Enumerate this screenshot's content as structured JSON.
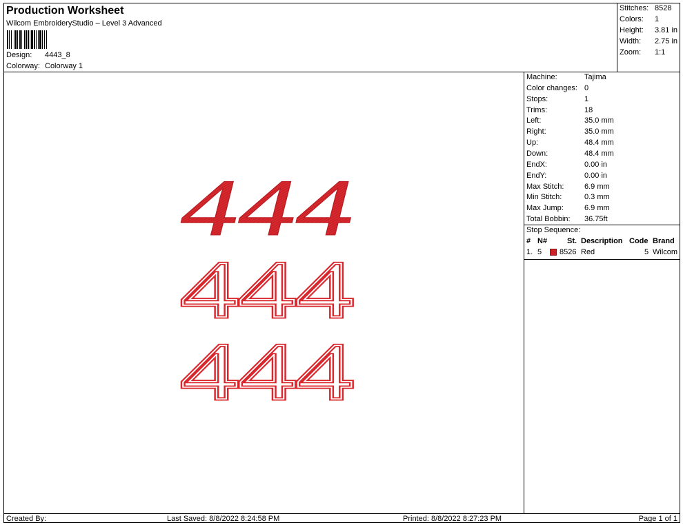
{
  "header": {
    "title": "Production Worksheet",
    "subtitle": "Wilcom EmbroideryStudio – Level 3 Advanced",
    "design_label": "Design:",
    "design_value": "4443_8",
    "colorway_label": "Colorway:",
    "colorway_value": "Colorway 1"
  },
  "top_stats": [
    {
      "label": "Stitches:",
      "value": "8528"
    },
    {
      "label": "Colors:",
      "value": "1"
    },
    {
      "label": "Height:",
      "value": "3.81 in"
    },
    {
      "label": "Width:",
      "value": "2.75 in"
    },
    {
      "label": "Zoom:",
      "value": "1:1"
    }
  ],
  "machine_info": [
    {
      "label": "Machine:",
      "value": "Tajima"
    },
    {
      "label": "Color changes:",
      "value": "0"
    },
    {
      "label": "Stops:",
      "value": "1"
    },
    {
      "label": "Trims:",
      "value": "18"
    },
    {
      "label": "Left:",
      "value": "35.0 mm"
    },
    {
      "label": "Right:",
      "value": "35.0 mm"
    },
    {
      "label": "Up:",
      "value": "48.4 mm"
    },
    {
      "label": "Down:",
      "value": "48.4 mm"
    },
    {
      "label": "EndX:",
      "value": "0.00 in"
    },
    {
      "label": "EndY:",
      "value": "0.00 in"
    },
    {
      "label": "Max Stitch:",
      "value": "6.9 mm"
    },
    {
      "label": "Min Stitch:",
      "value": "0.3 mm"
    },
    {
      "label": "Max Jump:",
      "value": "6.9 mm"
    },
    {
      "label": "Total Bobbin:",
      "value": "36.75ft"
    }
  ],
  "stop_sequence": {
    "label": "Stop Sequence:",
    "headers": {
      "num": "#",
      "n": "N#",
      "st": "St.",
      "description": "Description",
      "code": "Code",
      "brand": "Brand"
    },
    "rows": [
      {
        "num": "1.",
        "n": "5",
        "color": "#cc2127",
        "st": "8526",
        "description": "Red",
        "code": "5",
        "brand": "Wilcom"
      }
    ]
  },
  "design_text": {
    "rows": [
      "444",
      "444",
      "444"
    ],
    "color": "#cc2127"
  },
  "footer": {
    "created_by": "Created By:",
    "last_saved": "Last Saved: 8/8/2022 8:24:58 PM",
    "printed": "Printed: 8/8/2022 8:27:23 PM",
    "page": "Page 1 of 1"
  }
}
